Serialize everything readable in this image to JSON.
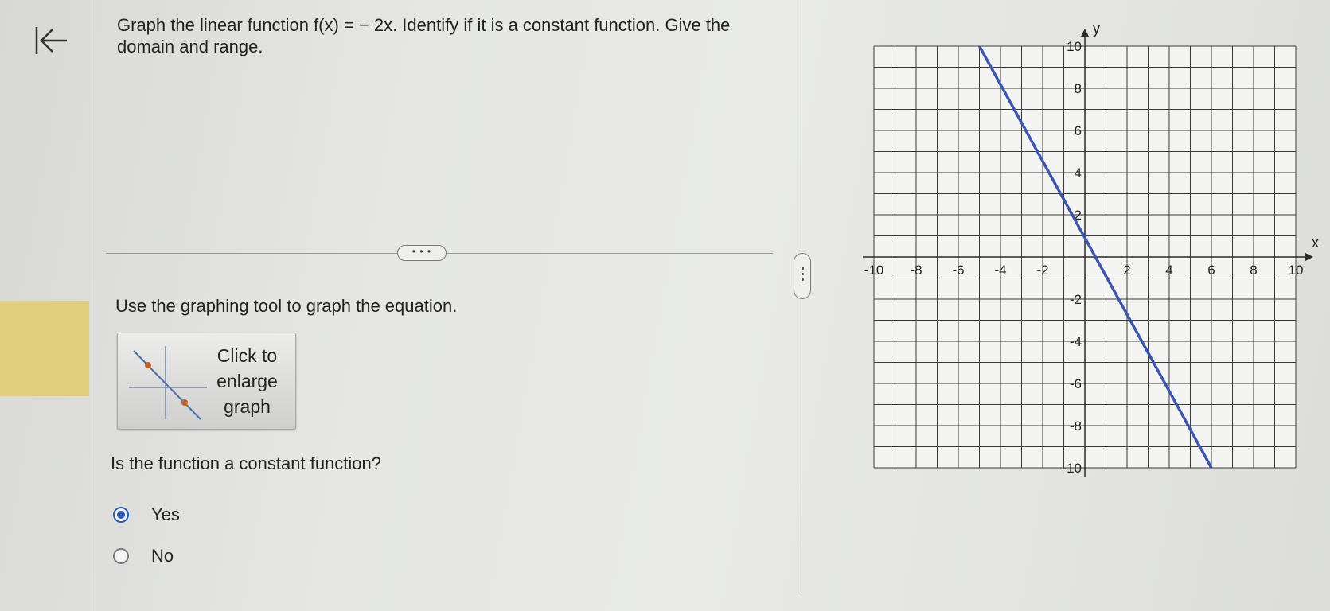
{
  "question": {
    "text": "Graph the linear function f(x) = − 2x. Identify if it is a constant function. Give the domain and range."
  },
  "divider_button": {
    "label": "• • •"
  },
  "instruction": "Use the graphing tool to graph the equation.",
  "graph_button": {
    "label_lines": [
      "Click to",
      "enlarge",
      "graph"
    ]
  },
  "constant_question": "Is the function a constant function?",
  "options": [
    {
      "label": "Yes",
      "selected": true
    },
    {
      "label": "No",
      "selected": false
    }
  ],
  "icons": {
    "back": "first-page-arrow-icon",
    "panel_handle": "vertical-ellipsis-icon"
  },
  "colors": {
    "line": "#3a56b0",
    "radio_selected": "#2b5db5",
    "marker": "#e1cf7e",
    "thumb_points": "#c4602a"
  },
  "chart_data": {
    "type": "line",
    "xlabel": "x",
    "ylabel": "y",
    "xlim": [
      -10,
      10
    ],
    "ylim": [
      -10,
      10
    ],
    "grid": true,
    "x_ticks": [
      -10,
      -8,
      -6,
      -4,
      -2,
      2,
      4,
      6,
      8,
      10
    ],
    "y_ticks": [
      10,
      8,
      6,
      4,
      2,
      -2,
      -4,
      -6,
      -8,
      -10
    ],
    "series": [
      {
        "x": [
          -5,
          6
        ],
        "y": [
          10,
          -10
        ]
      }
    ]
  }
}
